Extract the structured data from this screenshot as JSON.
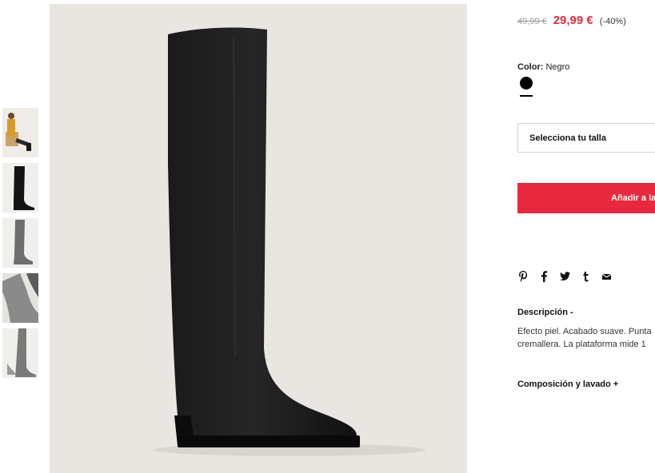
{
  "thumbnails": [
    {
      "alt": "model-seated-view"
    },
    {
      "alt": "boot-side-view"
    },
    {
      "alt": "boot-worn-view"
    },
    {
      "alt": "boot-detail-view"
    },
    {
      "alt": "boot-back-view"
    }
  ],
  "product": {
    "old_price": "49,99 €",
    "new_price": "29,99 €",
    "discount": "(-40%)",
    "color_label": "Color:",
    "color_value": "Negro",
    "size_placeholder": "Selecciona tu talla",
    "add_button": "Añadir a la",
    "description_title": "Descripción  -",
    "description_text": "Efecto piel. Acabado suave. Punta cremallera. La plataforma mide 1",
    "composition_title": "Composición y lavado  +"
  },
  "social_icons": [
    "pinterest-icon",
    "facebook-icon",
    "twitter-icon",
    "tumblr-icon",
    "email-icon"
  ],
  "colors": {
    "accent": "#e8283c",
    "price_red": "#e22d3b",
    "image_bg": "#e9e6e1"
  }
}
